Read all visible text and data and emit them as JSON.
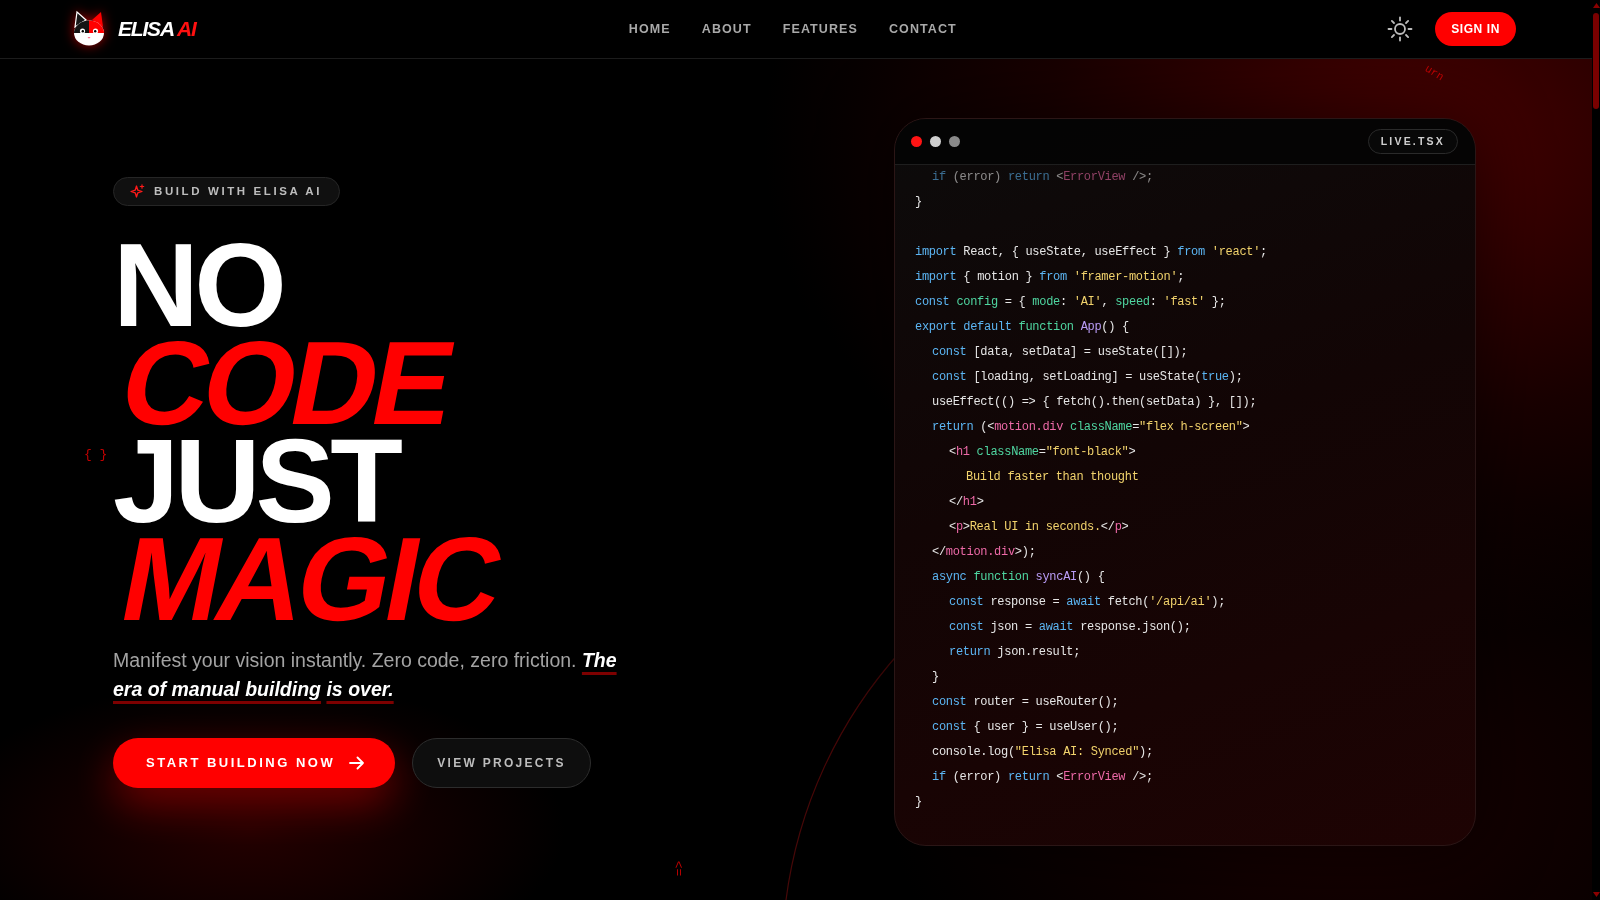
{
  "navbar": {
    "brand": {
      "text": "ELISA",
      "accent": "AI"
    },
    "links": [
      "HOME",
      "ABOUT",
      "FEATURES",
      "CONTACT"
    ],
    "sign_in": "SIGN IN"
  },
  "hero": {
    "badge": "BUILD WITH ELISA AI",
    "headline": [
      {
        "text": "NO",
        "kind": "plain"
      },
      {
        "text": "CODE",
        "kind": "accent"
      },
      {
        "text": "JUST",
        "kind": "plain"
      },
      {
        "text": "MAGIC",
        "kind": "accent"
      }
    ],
    "subtitle": "Manifest your vision instantly. Zero code, zero friction. **The era of manual building** **is over.**",
    "buttons": [
      {
        "label": "START BUILDING NOW",
        "kind": "primary"
      },
      {
        "label": "VIEW PROJECTS",
        "kind": "secondary"
      }
    ]
  },
  "code_window": {
    "dots": [
      {
        "color": "#ff1414"
      },
      {
        "color": "#cfcfcf"
      },
      {
        "color": "#8a8a8a"
      }
    ],
    "file_name": "LIVE.TSX",
    "snippets": [
      {
        "lines": [
          {
            "children": [
              {
                "tokens": [
                  {
                    "text": "if",
                    "kind": "keyword"
                  },
                  {
                    "text": " (error)",
                    "kind": "plain"
                  },
                  {
                    "text": " return",
                    "kind": "keyword"
                  },
                  {
                    "text": " <",
                    "kind": "plain"
                  },
                  {
                    "text": "ErrorView",
                    "kind": "tag"
                  },
                  {
                    "text": " />;",
                    "kind": "plain"
                  }
                ]
              }
            ]
          },
          {
            "tokens": [
              {
                "text": "}",
                "kind": "plain"
              }
            ]
          }
        ]
      },
      {
        "lines": [
          {
            "tokens": [
              {
                "text": "import",
                "kind": "keyword"
              },
              {
                "text": " React, { useState, useEffect }",
                "kind": "plain"
              },
              {
                "text": " from",
                "kind": "keyword"
              },
              {
                "text": " 'react'",
                "kind": "string"
              },
              {
                "text": ";",
                "kind": "plain"
              }
            ]
          },
          {
            "tokens": [
              {
                "text": "import",
                "kind": "keyword"
              },
              {
                "text": " { motion }",
                "kind": "plain"
              },
              {
                "text": " from",
                "kind": "keyword"
              },
              {
                "text": " 'framer-motion'",
                "kind": "string"
              },
              {
                "text": ";",
                "kind": "plain"
              }
            ]
          },
          {
            "tokens": [
              {
                "text": "const",
                "kind": "keyword"
              },
              {
                "text": " config",
                "kind": "identifier"
              },
              {
                "text": " = {",
                "kind": "plain"
              },
              {
                "text": " mode",
                "kind": "identifier"
              },
              {
                "text": ":",
                "kind": "plain"
              },
              {
                "text": " 'AI'",
                "kind": "string"
              },
              {
                "text": ",",
                "kind": "plain"
              },
              {
                "text": " speed",
                "kind": "identifier"
              },
              {
                "text": ":",
                "kind": "plain"
              },
              {
                "text": " 'fast'",
                "kind": "string"
              },
              {
                "text": " };",
                "kind": "plain"
              }
            ]
          },
          {
            "tokens": [
              {
                "text": "export default",
                "kind": "keyword"
              },
              {
                "text": " function",
                "kind": "identifier"
              },
              {
                "text": " App",
                "kind": "function"
              },
              {
                "text": "() {",
                "kind": "plain"
              }
            ],
            "children": [
              {
                "tokens": [
                  {
                    "text": "const",
                    "kind": "keyword"
                  },
                  {
                    "text": " [data, setData] = useState([]);",
                    "kind": "plain"
                  }
                ]
              },
              {
                "tokens": [
                  {
                    "text": "const",
                    "kind": "keyword"
                  },
                  {
                    "text": " [loading, setLoading] = useState(",
                    "kind": "plain"
                  },
                  {
                    "text": "true",
                    "kind": "keyword"
                  },
                  {
                    "text": ");",
                    "kind": "plain"
                  }
                ]
              },
              {
                "tokens": [
                  {
                    "text": "useEffect(() => { fetch().then(setData) }, []);",
                    "kind": "plain"
                  }
                ]
              },
              {
                "tokens": [
                  {
                    "text": "return",
                    "kind": "keyword"
                  },
                  {
                    "text": " (<",
                    "kind": "plain"
                  },
                  {
                    "text": "motion.div",
                    "kind": "tag"
                  },
                  {
                    "text": " className",
                    "kind": "identifier"
                  },
                  {
                    "text": "=",
                    "kind": "plain"
                  },
                  {
                    "text": "\"flex h-screen\"",
                    "kind": "string"
                  },
                  {
                    "text": ">",
                    "kind": "plain"
                  }
                ],
                "children": [
                  {
                    "tokens": [
                      {
                        "text": "<",
                        "kind": "plain"
                      },
                      {
                        "text": "h1",
                        "kind": "tag"
                      },
                      {
                        "text": " className",
                        "kind": "identifier"
                      },
                      {
                        "text": "=",
                        "kind": "plain"
                      },
                      {
                        "text": "\"font-black\"",
                        "kind": "string"
                      },
                      {
                        "text": ">",
                        "kind": "plain"
                      }
                    ],
                    "children": [
                      {
                        "tokens": [
                          {
                            "text": "Build faster than thought",
                            "kind": "string"
                          }
                        ]
                      }
                    ]
                  },
                  {
                    "tokens": [
                      {
                        "text": "</",
                        "kind": "plain"
                      },
                      {
                        "text": "h1",
                        "kind": "tag"
                      },
                      {
                        "text": ">",
                        "kind": "plain"
                      }
                    ]
                  },
                  {
                    "tokens": [
                      {
                        "text": "<",
                        "kind": "plain"
                      },
                      {
                        "text": "p",
                        "kind": "tag"
                      },
                      {
                        "text": ">",
                        "kind": "plain"
                      },
                      {
                        "text": "Real UI in seconds.",
                        "kind": "string"
                      },
                      {
                        "text": "</",
                        "kind": "plain"
                      },
                      {
                        "text": "p",
                        "kind": "tag"
                      },
                      {
                        "text": ">",
                        "kind": "plain"
                      }
                    ]
                  }
                ]
              },
              {
                "tokens": [
                  {
                    "text": "</",
                    "kind": "plain"
                  },
                  {
                    "text": "motion.div",
                    "kind": "tag"
                  },
                  {
                    "text": ">);",
                    "kind": "plain"
                  }
                ]
              },
              {
                "tokens": [
                  {
                    "text": "async",
                    "kind": "keyword"
                  },
                  {
                    "text": " function",
                    "kind": "identifier"
                  },
                  {
                    "text": " syncAI",
                    "kind": "function"
                  },
                  {
                    "text": "() {",
                    "kind": "plain"
                  }
                ],
                "children": [
                  {
                    "tokens": [
                      {
                        "text": "const",
                        "kind": "keyword"
                      },
                      {
                        "text": " response =",
                        "kind": "plain"
                      },
                      {
                        "text": " await",
                        "kind": "keyword"
                      },
                      {
                        "text": " fetch(",
                        "kind": "plain"
                      },
                      {
                        "text": "'/api/ai'",
                        "kind": "string"
                      },
                      {
                        "text": ");",
                        "kind": "plain"
                      }
                    ]
                  },
                  {
                    "tokens": [
                      {
                        "text": "const",
                        "kind": "keyword"
                      },
                      {
                        "text": " json =",
                        "kind": "plain"
                      },
                      {
                        "text": " await",
                        "kind": "keyword"
                      },
                      {
                        "text": " response.json();",
                        "kind": "plain"
                      }
                    ]
                  },
                  {
                    "tokens": [
                      {
                        "text": "return",
                        "kind": "keyword"
                      },
                      {
                        "text": " json.result;",
                        "kind": "plain"
                      }
                    ]
                  }
                ]
              },
              {
                "tokens": [
                  {
                    "text": "}",
                    "kind": "plain"
                  }
                ]
              },
              {
                "tokens": [
                  {
                    "text": "const",
                    "kind": "keyword"
                  },
                  {
                    "text": " router = useRouter();",
                    "kind": "plain"
                  }
                ]
              },
              {
                "tokens": [
                  {
                    "text": "const",
                    "kind": "keyword"
                  },
                  {
                    "text": " { user } = useUser();",
                    "kind": "plain"
                  }
                ]
              },
              {
                "tokens": [
                  {
                    "text": "console.log(",
                    "kind": "plain"
                  },
                  {
                    "text": "\"Elisa AI: Synced\"",
                    "kind": "string"
                  },
                  {
                    "text": ");",
                    "kind": "plain"
                  }
                ]
              },
              {
                "tokens": [
                  {
                    "text": "if",
                    "kind": "keyword"
                  },
                  {
                    "text": " (error)",
                    "kind": "plain"
                  },
                  {
                    "text": " return",
                    "kind": "keyword"
                  },
                  {
                    "text": " <",
                    "kind": "plain"
                  },
                  {
                    "text": "ErrorView",
                    "kind": "tag"
                  },
                  {
                    "text": " />;",
                    "kind": "plain"
                  }
                ]
              }
            ]
          },
          {
            "tokens": [
              {
                "text": "}",
                "kind": "plain"
              }
            ]
          }
        ]
      }
    ]
  },
  "floating_symbols": [
    "{ }",
    "urn",
    "=>"
  ]
}
